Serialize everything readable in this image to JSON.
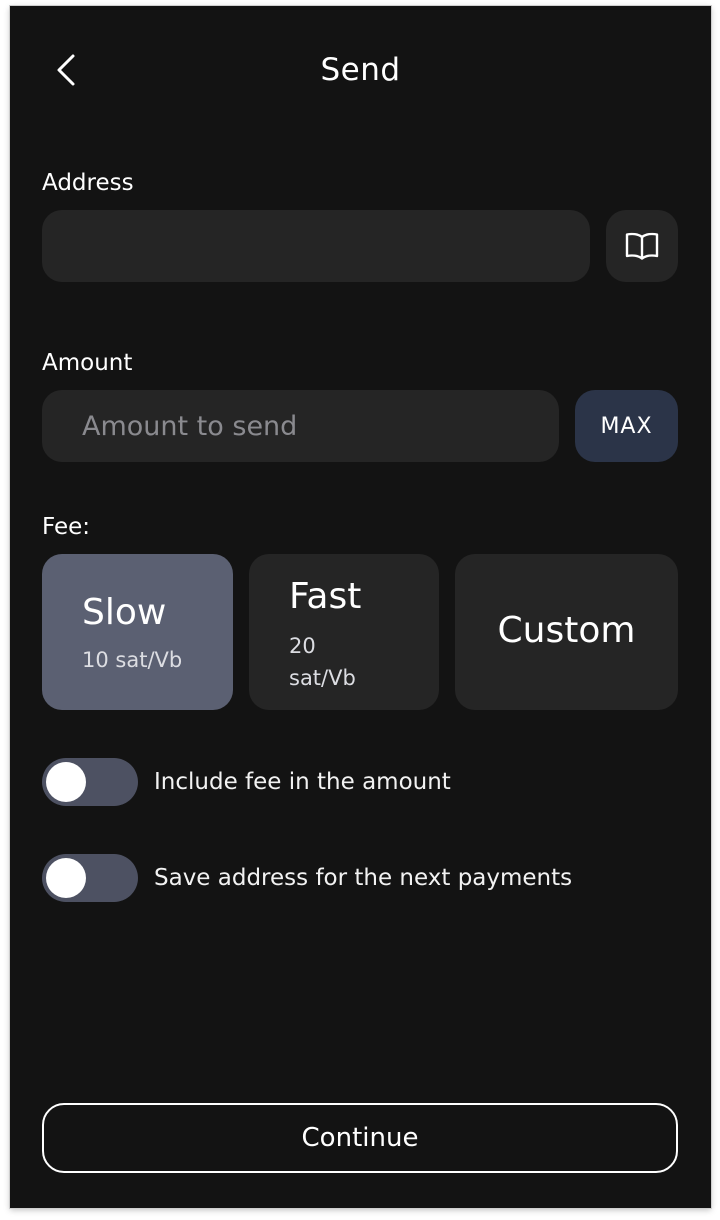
{
  "header": {
    "title": "Send",
    "back_icon": "chevron-left-icon"
  },
  "address": {
    "label": "Address",
    "value": "",
    "placeholder": "",
    "book_icon": "address-book-icon"
  },
  "amount": {
    "label": "Amount",
    "value": "",
    "placeholder": "Amount to send",
    "max_label": "MAX"
  },
  "fee": {
    "label": "Fee:",
    "options": [
      {
        "name": "Slow",
        "rate": "10 sat/Vb",
        "selected": true
      },
      {
        "name": "Fast",
        "rate_value": "20",
        "rate_unit": "sat/Vb",
        "selected": false
      },
      {
        "name": "Custom",
        "selected": false
      }
    ]
  },
  "toggles": [
    {
      "label": "Include fee in the amount",
      "on": false
    },
    {
      "label": "Save address for the next payments",
      "on": false
    }
  ],
  "continue_label": "Continue",
  "colors": {
    "background": "#131313",
    "field": "#252525",
    "selected_fee": "#5b6072",
    "max_button": "#2b3448"
  }
}
